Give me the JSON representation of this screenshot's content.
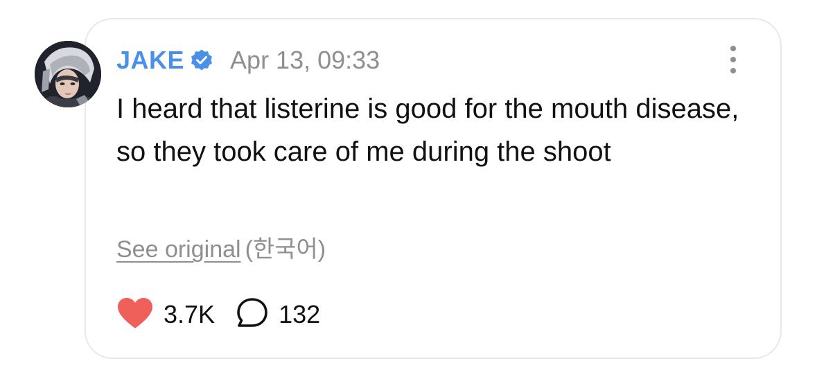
{
  "post": {
    "author": "JAKE",
    "timestamp": "Apr 13, 09:33",
    "text": "I heard that listerine is good for the mouth disease, so they took care of me during the shoot",
    "see_original_label": "See original",
    "original_language": "(한국어)",
    "likes_count": "3.7K",
    "comments_count": "132"
  },
  "icons": {
    "verified": "verified-badge-icon",
    "more": "more-vertical-icon",
    "like": "heart-icon",
    "comment": "speech-bubble-icon"
  },
  "colors": {
    "author": "#4a90e8",
    "verified_badge": "#4a90e8",
    "heart": "#f0605a",
    "muted_text": "#8e8e93",
    "body_text": "#111111",
    "card_border": "#e7e7ec"
  }
}
